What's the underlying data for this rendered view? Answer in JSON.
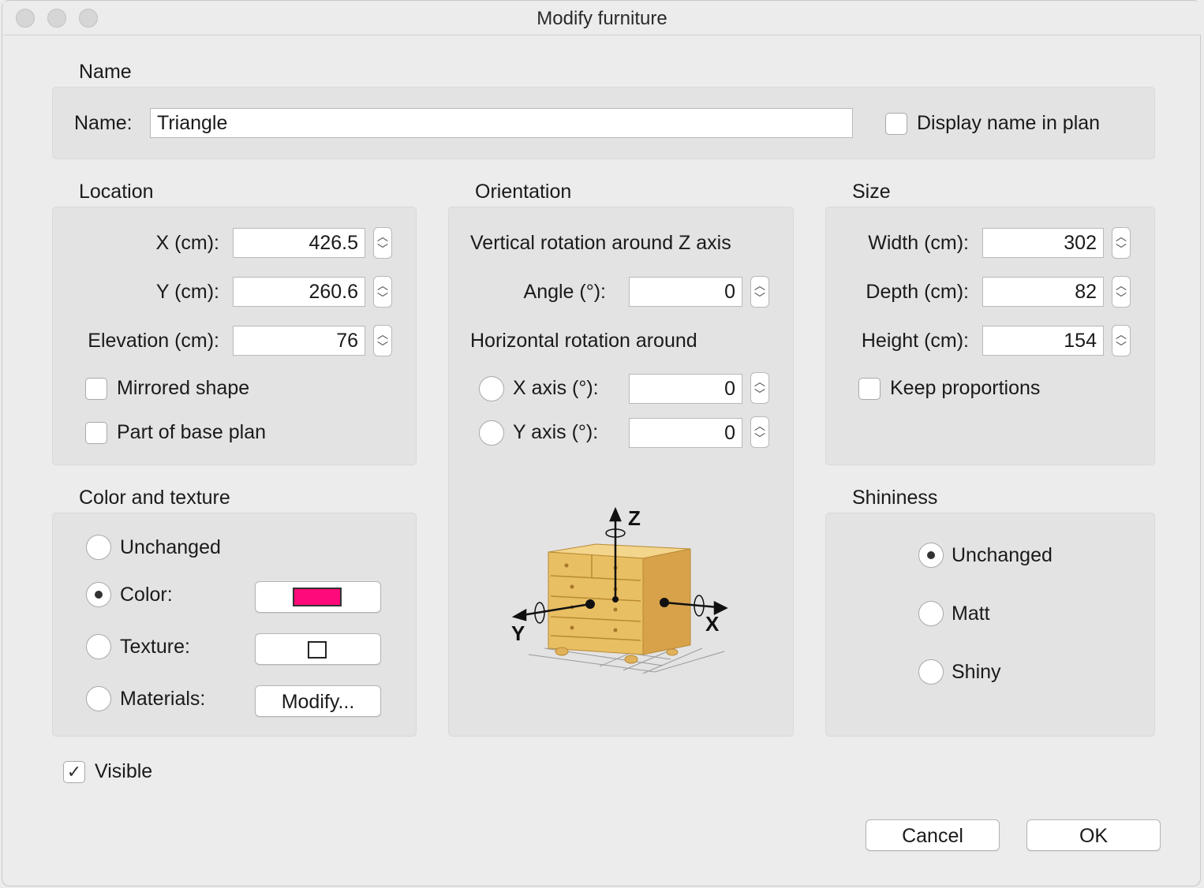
{
  "window": {
    "title": "Modify furniture"
  },
  "name_section": {
    "header": "Name",
    "name_label": "Name:",
    "name_value": "Triangle",
    "display_name_label": "Display name in plan",
    "display_name_checked": false
  },
  "location": {
    "header": "Location",
    "x_label": "X (cm):",
    "x_value": "426.5",
    "y_label": "Y (cm):",
    "y_value": "260.6",
    "elevation_label": "Elevation (cm):",
    "elevation_value": "76",
    "mirrored_label": "Mirrored shape",
    "mirrored_checked": false,
    "base_plan_label": "Part of base plan",
    "base_plan_checked": false
  },
  "orientation": {
    "header": "Orientation",
    "vertical_title": "Vertical rotation around Z axis",
    "angle_label": "Angle (°):",
    "angle_value": "0",
    "horizontal_title": "Horizontal rotation around",
    "x_axis_label": "X axis (°):",
    "x_axis_value": "0",
    "y_axis_label": "Y axis (°):",
    "y_axis_value": "0",
    "axis_z": "Z",
    "axis_x": "X",
    "axis_y": "Y"
  },
  "size": {
    "header": "Size",
    "width_label": "Width (cm):",
    "width_value": "302",
    "depth_label": "Depth (cm):",
    "depth_value": "82",
    "height_label": "Height (cm):",
    "height_value": "154",
    "keep_proportions_label": "Keep proportions",
    "keep_proportions_checked": false
  },
  "color_texture": {
    "header": "Color and texture",
    "unchanged_label": "Unchanged",
    "color_label": "Color:",
    "texture_label": "Texture:",
    "materials_label": "Materials:",
    "modify_button": "Modify...",
    "selected": "color",
    "color_value": "#ff0a7a"
  },
  "shininess": {
    "header": "Shininess",
    "unchanged_label": "Unchanged",
    "matt_label": "Matt",
    "shiny_label": "Shiny",
    "selected": "unchanged"
  },
  "visible": {
    "label": "Visible",
    "checked": true
  },
  "buttons": {
    "cancel": "Cancel",
    "ok": "OK"
  }
}
